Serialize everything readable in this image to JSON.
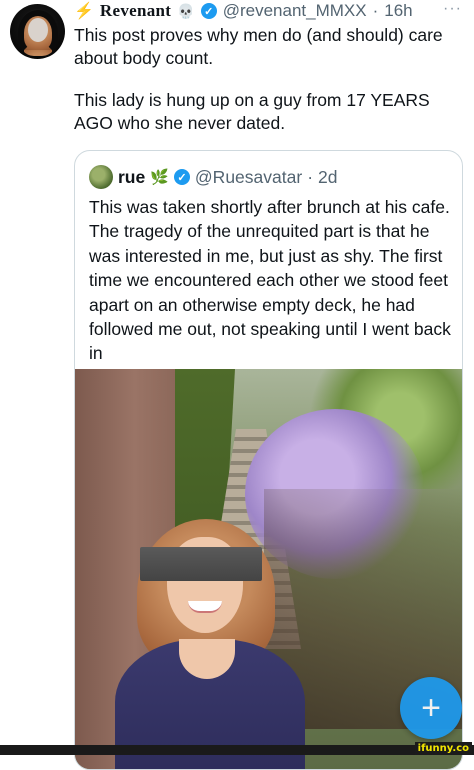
{
  "post": {
    "display_name": "Revenant",
    "handle": "@revenant_MMXX",
    "separator": "·",
    "time": "16h",
    "more": "···",
    "icons": {
      "prefix": "lightning-icon",
      "suffix": "skull-icon",
      "verified": "verified-badge-icon"
    },
    "lines": [
      "This post proves why men do (and should) care about body count.",
      "This lady is hung up on a guy from 17 YEARS AGO who she never dated."
    ]
  },
  "quote": {
    "display_name": "rue",
    "handle": "@Ruesavatar",
    "separator": "·",
    "time": "2d",
    "icons": {
      "suffix": "herb-icon",
      "verified": "verified-badge-icon"
    },
    "text": "This was taken shortly after brunch at his cafe. The tragedy of the unrequited part is that he was interested in me, but just as shy. The first time we encountered each other we stood feet apart on an otherwise empty deck, he had followed me out, not speaking until I went back in"
  },
  "compose_button": {
    "icon": "plus-icon",
    "label": "+"
  },
  "watermark": "ifunny.co",
  "colors": {
    "accent": "#1d9bf0",
    "muted": "#536471",
    "border": "#cfd9de"
  }
}
